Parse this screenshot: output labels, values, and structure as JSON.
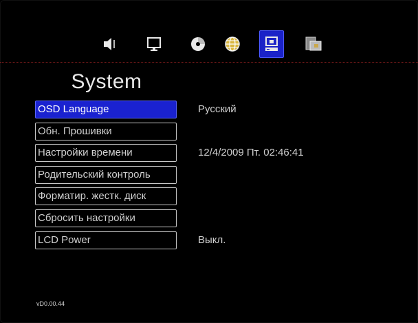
{
  "header": {
    "title": "System"
  },
  "toolbar": {
    "icons": [
      {
        "name": "speaker-icon"
      },
      {
        "name": "monitor-icon"
      },
      {
        "name": "disc-icon"
      },
      {
        "name": "globe-icon"
      },
      {
        "name": "system-icon",
        "active": true
      },
      {
        "name": "photo-icon"
      }
    ],
    "accent": "#1a22c8"
  },
  "menu": {
    "items": [
      {
        "label": "OSD Language",
        "value": "Русский",
        "selected": true
      },
      {
        "label": "Обн. Прошивки",
        "value": ""
      },
      {
        "label": "Настройки времени",
        "value": "12/4/2009 Пт. 02:46:41"
      },
      {
        "label": "Родительский контроль",
        "value": ""
      },
      {
        "label": "Форматир. жестк. диск",
        "value": ""
      },
      {
        "label": "Сбросить настройки",
        "value": ""
      },
      {
        "label": "LCD Power",
        "value": "Выкл."
      }
    ]
  },
  "footer": {
    "version": "vD0.00.44"
  }
}
